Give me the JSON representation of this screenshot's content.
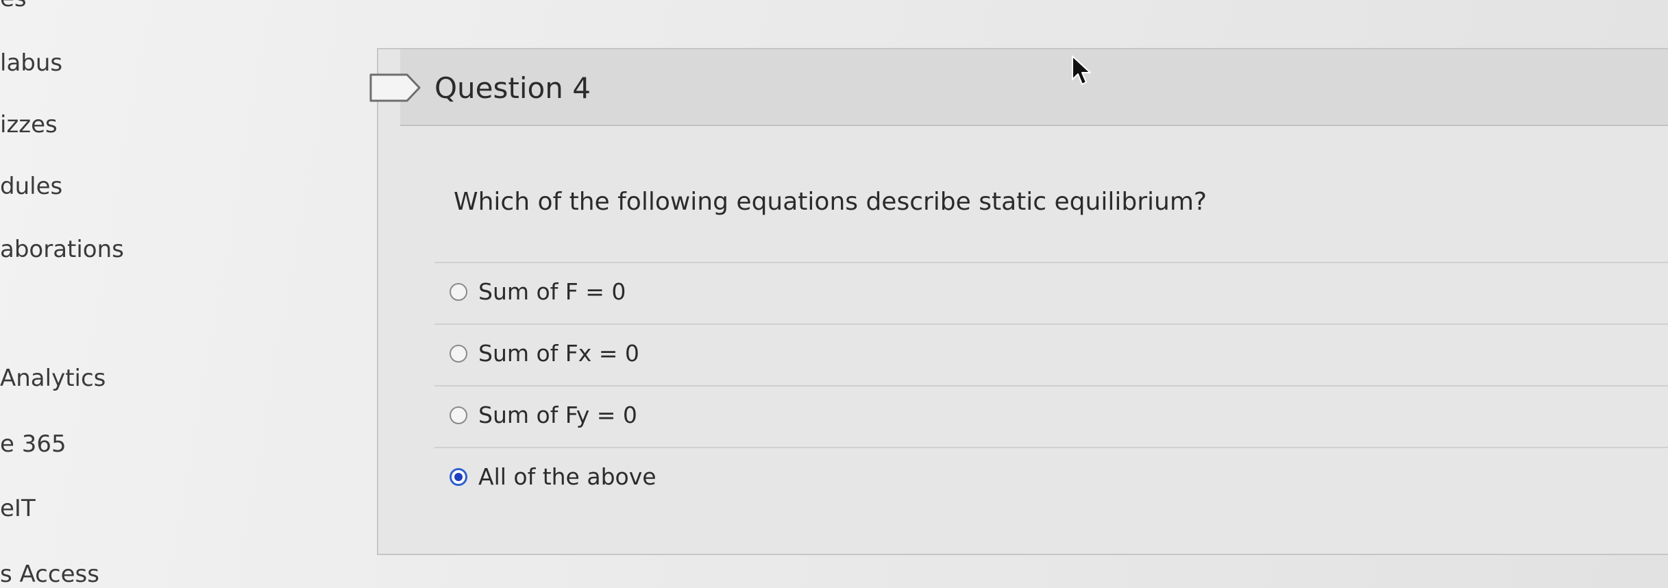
{
  "course_nav": {
    "items": [
      "es",
      "labus",
      "izzes",
      "dules",
      "aborations",
      "Analytics",
      "e 365",
      "eIT",
      "s Access"
    ]
  },
  "question": {
    "title": "Question 4",
    "text": "Which of the following equations describe static equilibrium?",
    "answers": [
      {
        "label": "Sum of F = 0",
        "selected": false
      },
      {
        "label": "Sum of Fx = 0",
        "selected": false
      },
      {
        "label": "Sum of Fy = 0",
        "selected": false
      },
      {
        "label": "All of the above",
        "selected": true
      }
    ]
  },
  "colors": {
    "radio_selected": "#1f3fbf",
    "text": "#2b2b2b",
    "card_background": "#e6e6e6"
  },
  "icons": {
    "flag": "flag-question-icon",
    "cursor": "mouse-cursor-icon"
  }
}
